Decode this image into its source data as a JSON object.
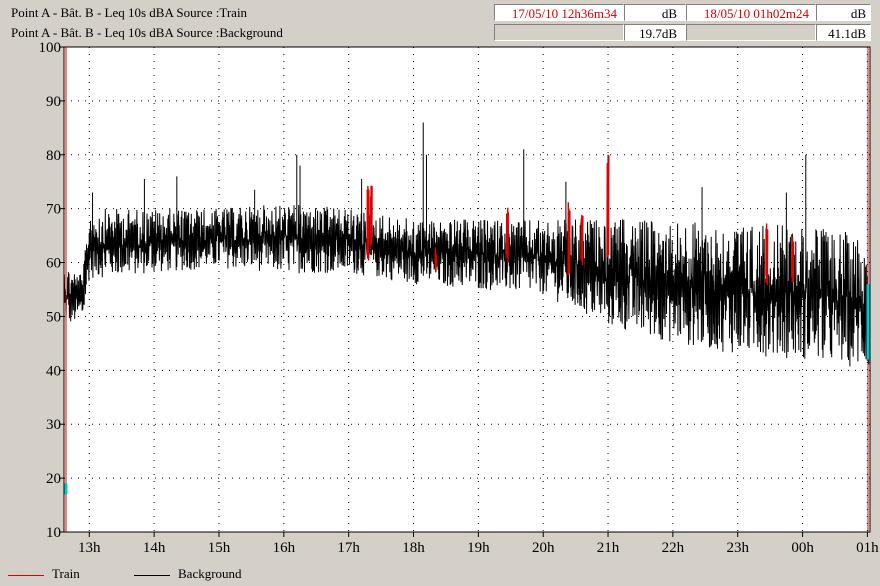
{
  "header": {
    "rows": [
      {
        "label": "Point A - Bât. B -  Leq 10s  dBA  Source :Train",
        "time_start": "17/05/10 12h36m34",
        "value_start": "dB",
        "time_end": "18/05/10 01h02m24",
        "value_end": "dB"
      },
      {
        "label": "Point A - Bât. B -  Leq 10s  dBA  Source :Background",
        "time_start": "",
        "value_start": "19.7dB",
        "time_end": "",
        "value_end": "41.1dB"
      }
    ]
  },
  "colors": {
    "train": "#e00000",
    "background": "#000000",
    "cursor": "#00c8c8",
    "grid": "#000000"
  },
  "chart_data": {
    "type": "line",
    "title": "",
    "xlabel": "",
    "ylabel": "",
    "ylim": [
      10,
      100
    ],
    "y_ticks": [
      "10",
      "20",
      "30",
      "40",
      "50",
      "60",
      "70",
      "80",
      "90",
      "100"
    ],
    "x_ticks": [
      "13h",
      "14h",
      "15h",
      "16h",
      "17h",
      "18h",
      "19h",
      "20h",
      "21h",
      "22h",
      "23h",
      "00h",
      "01h"
    ],
    "xlim_hours": [
      12.61,
      25.04
    ],
    "grid": true,
    "legend_position": "bottom-left",
    "series": [
      {
        "name": "Background",
        "color": "#000000",
        "envelope": [
          {
            "x": 12.61,
            "lo": 48,
            "hi": 60
          },
          {
            "x": 12.9,
            "lo": 49,
            "hi": 58
          },
          {
            "x": 13.0,
            "lo": 57,
            "hi": 70
          },
          {
            "x": 14.0,
            "lo": 58,
            "hi": 70
          },
          {
            "x": 15.0,
            "lo": 59,
            "hi": 70
          },
          {
            "x": 16.0,
            "lo": 58,
            "hi": 71
          },
          {
            "x": 17.0,
            "lo": 58,
            "hi": 70
          },
          {
            "x": 18.0,
            "lo": 56,
            "hi": 68
          },
          {
            "x": 19.0,
            "lo": 55,
            "hi": 68
          },
          {
            "x": 20.0,
            "lo": 54,
            "hi": 68
          },
          {
            "x": 21.0,
            "lo": 48,
            "hi": 68
          },
          {
            "x": 22.0,
            "lo": 45,
            "hi": 68
          },
          {
            "x": 23.0,
            "lo": 43,
            "hi": 67
          },
          {
            "x": 24.0,
            "lo": 42,
            "hi": 67
          },
          {
            "x": 25.04,
            "lo": 40,
            "hi": 65
          }
        ],
        "peaks": [
          {
            "x": 13.05,
            "y": 73
          },
          {
            "x": 13.85,
            "y": 75.5
          },
          {
            "x": 14.35,
            "y": 76
          },
          {
            "x": 15.55,
            "y": 73.5
          },
          {
            "x": 16.2,
            "y": 80
          },
          {
            "x": 16.25,
            "y": 78
          },
          {
            "x": 17.2,
            "y": 75.5
          },
          {
            "x": 18.15,
            "y": 86
          },
          {
            "x": 18.2,
            "y": 80
          },
          {
            "x": 19.7,
            "y": 81
          },
          {
            "x": 20.35,
            "y": 75
          },
          {
            "x": 21.0,
            "y": 80
          },
          {
            "x": 22.45,
            "y": 74
          },
          {
            "x": 23.75,
            "y": 73
          },
          {
            "x": 24.05,
            "y": 80
          }
        ]
      },
      {
        "name": "Train",
        "color": "#e00000",
        "events": [
          {
            "x": 17.3,
            "lo": 60,
            "hi": 75
          },
          {
            "x": 17.35,
            "lo": 62,
            "hi": 75
          },
          {
            "x": 18.35,
            "lo": 57,
            "hi": 63
          },
          {
            "x": 19.45,
            "lo": 60,
            "hi": 72
          },
          {
            "x": 20.4,
            "lo": 57,
            "hi": 72
          },
          {
            "x": 20.6,
            "lo": 58,
            "hi": 71
          },
          {
            "x": 21.0,
            "lo": 60,
            "hi": 80
          },
          {
            "x": 23.45,
            "lo": 55,
            "hi": 69
          },
          {
            "x": 23.85,
            "lo": 56,
            "hi": 65
          }
        ]
      }
    ]
  },
  "legend": {
    "items": [
      {
        "label": "Train",
        "color": "#e00000"
      },
      {
        "label": "Background",
        "color": "#000000"
      }
    ]
  }
}
